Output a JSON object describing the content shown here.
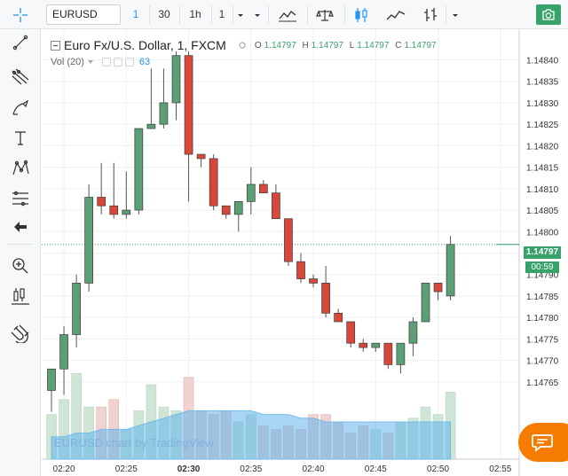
{
  "toolbar": {
    "symbol": "EURUSD",
    "intervals": [
      "1",
      "30",
      "1h",
      "1"
    ],
    "active_interval": "1",
    "icons": [
      "crosshair-icon",
      "indicators-icon",
      "compare-icon",
      "candles-icon",
      "area-icon",
      "bars-icon",
      "camera-icon"
    ]
  },
  "legend": {
    "title": "Euro Fx/U.S. Dollar, 1, FXCM",
    "o_label": "O",
    "o": "1.14797",
    "h_label": "H",
    "h": "1.14797",
    "l_label": "L",
    "l": "1.14797",
    "c_label": "C",
    "c": "1.14797",
    "vol_label": "Vol (20)",
    "vol_value": "63"
  },
  "left_tools": [
    "crosshair-icon",
    "trendline-icon",
    "pitchfork-icon",
    "brush-icon",
    "text-icon",
    "pattern-icon",
    "fib-icon",
    "back-arrow-icon",
    "zoom-icon",
    "measure-icon",
    "magnet-icon"
  ],
  "watermark": "EURUSD chart by TradingView",
  "price_tag": "1.14797",
  "time_tag": "00:59",
  "colors": {
    "up": "#5c9f76",
    "down": "#d9473a",
    "vol_up": "#cfe5d5",
    "vol_down": "#f0d2d0",
    "accent": "#2196f3",
    "chat": "#f57c00"
  },
  "chart_data": {
    "type": "candlestick",
    "y_ticks": [
      "1.14840",
      "1.14835",
      "1.14830",
      "1.14825",
      "1.14820",
      "1.14815",
      "1.14810",
      "1.14805",
      "1.14800",
      "1.14795",
      "1.14790",
      "1.14785",
      "1.14780",
      "1.14775",
      "1.14770",
      "1.14765"
    ],
    "ylim": [
      1.1476,
      1.14843
    ],
    "x_ticks": [
      "02:20",
      "02:25",
      "02:30",
      "02:35",
      "02:40",
      "02:45",
      "02:50",
      "02:55"
    ],
    "x_tick_minutes": [
      20,
      25,
      30,
      35,
      40,
      45,
      50,
      55
    ],
    "last_price": 1.14797,
    "candles": [
      {
        "t": 19,
        "o": 1.14763,
        "h": 1.14768,
        "l": 1.14758,
        "c": 1.14768
      },
      {
        "t": 20,
        "o": 1.14768,
        "h": 1.14778,
        "l": 1.14762,
        "c": 1.14776
      },
      {
        "t": 21,
        "o": 1.14776,
        "h": 1.1479,
        "l": 1.14773,
        "c": 1.14788
      },
      {
        "t": 22,
        "o": 1.14788,
        "h": 1.14811,
        "l": 1.14786,
        "c": 1.14808
      },
      {
        "t": 23,
        "o": 1.14808,
        "h": 1.14816,
        "l": 1.14804,
        "c": 1.14806
      },
      {
        "t": 24,
        "o": 1.14806,
        "h": 1.14816,
        "l": 1.14803,
        "c": 1.14804
      },
      {
        "t": 25,
        "o": 1.14804,
        "h": 1.14814,
        "l": 1.14803,
        "c": 1.14805
      },
      {
        "t": 26,
        "o": 1.14805,
        "h": 1.14824,
        "l": 1.14804,
        "c": 1.14824
      },
      {
        "t": 27,
        "o": 1.14824,
        "h": 1.14838,
        "l": 1.14824,
        "c": 1.14825
      },
      {
        "t": 28,
        "o": 1.14825,
        "h": 1.14838,
        "l": 1.14824,
        "c": 1.1483
      },
      {
        "t": 29,
        "o": 1.1483,
        "h": 1.14842,
        "l": 1.14826,
        "c": 1.14841
      },
      {
        "t": 30,
        "o": 1.14841,
        "h": 1.14842,
        "l": 1.14807,
        "c": 1.14818
      },
      {
        "t": 31,
        "o": 1.14818,
        "h": 1.14818,
        "l": 1.14815,
        "c": 1.14817
      },
      {
        "t": 32,
        "o": 1.14817,
        "h": 1.14818,
        "l": 1.14805,
        "c": 1.14806
      },
      {
        "t": 33,
        "o": 1.14806,
        "h": 1.14806,
        "l": 1.14803,
        "c": 1.14804
      },
      {
        "t": 34,
        "o": 1.14804,
        "h": 1.14807,
        "l": 1.148,
        "c": 1.14807
      },
      {
        "t": 35,
        "o": 1.14807,
        "h": 1.14815,
        "l": 1.14804,
        "c": 1.14811
      },
      {
        "t": 36,
        "o": 1.14811,
        "h": 1.14812,
        "l": 1.14809,
        "c": 1.14809
      },
      {
        "t": 37,
        "o": 1.14809,
        "h": 1.14811,
        "l": 1.14803,
        "c": 1.14803
      },
      {
        "t": 38,
        "o": 1.14803,
        "h": 1.14803,
        "l": 1.14792,
        "c": 1.14793
      },
      {
        "t": 39,
        "o": 1.14793,
        "h": 1.14795,
        "l": 1.14788,
        "c": 1.14789
      },
      {
        "t": 40,
        "o": 1.14789,
        "h": 1.1479,
        "l": 1.14787,
        "c": 1.14788
      },
      {
        "t": 41,
        "o": 1.14788,
        "h": 1.14792,
        "l": 1.1478,
        "c": 1.14781
      },
      {
        "t": 42,
        "o": 1.14781,
        "h": 1.14782,
        "l": 1.14779,
        "c": 1.14779
      },
      {
        "t": 43,
        "o": 1.14779,
        "h": 1.14779,
        "l": 1.14773,
        "c": 1.14774
      },
      {
        "t": 44,
        "o": 1.14774,
        "h": 1.14775,
        "l": 1.14772,
        "c": 1.14773
      },
      {
        "t": 45,
        "o": 1.14773,
        "h": 1.14774,
        "l": 1.14772,
        "c": 1.14774
      },
      {
        "t": 46,
        "o": 1.14774,
        "h": 1.14774,
        "l": 1.14768,
        "c": 1.14769
      },
      {
        "t": 47,
        "o": 1.14769,
        "h": 1.14774,
        "l": 1.14767,
        "c": 1.14774
      },
      {
        "t": 48,
        "o": 1.14774,
        "h": 1.1478,
        "l": 1.14771,
        "c": 1.14779
      },
      {
        "t": 49,
        "o": 1.14779,
        "h": 1.14788,
        "l": 1.14779,
        "c": 1.14788
      },
      {
        "t": 50,
        "o": 1.14788,
        "h": 1.14788,
        "l": 1.14784,
        "c": 1.14786
      },
      {
        "t": 51,
        "o": 1.14785,
        "h": 1.14799,
        "l": 1.14784,
        "c": 1.14797
      }
    ],
    "volumes": [
      {
        "t": 19,
        "v": 12,
        "up": true
      },
      {
        "t": 20,
        "v": 16,
        "up": true
      },
      {
        "t": 21,
        "v": 23,
        "up": true
      },
      {
        "t": 22,
        "v": 14,
        "up": true
      },
      {
        "t": 23,
        "v": 14,
        "up": false
      },
      {
        "t": 24,
        "v": 16,
        "up": false
      },
      {
        "t": 25,
        "v": 8,
        "up": true
      },
      {
        "t": 26,
        "v": 13,
        "up": true
      },
      {
        "t": 27,
        "v": 20,
        "up": true
      },
      {
        "t": 28,
        "v": 14,
        "up": true
      },
      {
        "t": 29,
        "v": 13,
        "up": true
      },
      {
        "t": 30,
        "v": 22,
        "up": false
      },
      {
        "t": 31,
        "v": 13,
        "up": false
      },
      {
        "t": 32,
        "v": 12,
        "up": false
      },
      {
        "t": 33,
        "v": 13,
        "up": false
      },
      {
        "t": 34,
        "v": 10,
        "up": true
      },
      {
        "t": 35,
        "v": 12,
        "up": true
      },
      {
        "t": 36,
        "v": 9,
        "up": false
      },
      {
        "t": 37,
        "v": 8,
        "up": false
      },
      {
        "t": 38,
        "v": 9,
        "up": false
      },
      {
        "t": 39,
        "v": 8,
        "up": false
      },
      {
        "t": 40,
        "v": 12,
        "up": false
      },
      {
        "t": 41,
        "v": 12,
        "up": false
      },
      {
        "t": 42,
        "v": 10,
        "up": false
      },
      {
        "t": 43,
        "v": 7,
        "up": false
      },
      {
        "t": 44,
        "v": 9,
        "up": false
      },
      {
        "t": 45,
        "v": 8,
        "up": true
      },
      {
        "t": 46,
        "v": 7,
        "up": false
      },
      {
        "t": 47,
        "v": 10,
        "up": true
      },
      {
        "t": 48,
        "v": 11,
        "up": true
      },
      {
        "t": 49,
        "v": 14,
        "up": true
      },
      {
        "t": 50,
        "v": 12,
        "up": true
      },
      {
        "t": 51,
        "v": 18,
        "up": true
      }
    ],
    "vol_ma": [
      6,
      6,
      7,
      7,
      8,
      8,
      8,
      9,
      10,
      11,
      12,
      13,
      13,
      13,
      13,
      13,
      13,
      12,
      12,
      12,
      11,
      11,
      10,
      10,
      10,
      10,
      10,
      10,
      10,
      10,
      10,
      10,
      10
    ]
  }
}
